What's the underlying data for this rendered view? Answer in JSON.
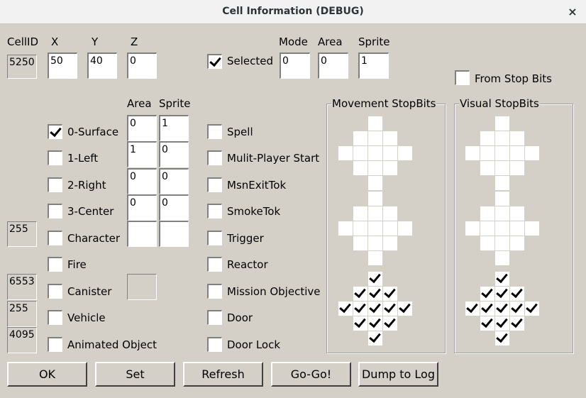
{
  "window": {
    "title": "Cell Information (DEBUG)",
    "close_glyph": "×"
  },
  "header": {
    "cellid_label": "CellID",
    "cellid_value": "5250",
    "x_label": "X",
    "x_value": "50",
    "y_label": "Y",
    "y_value": "40",
    "z_label": "Z",
    "z_value": "0",
    "selected_label": "Selected",
    "selected_checked": true,
    "mode_label": "Mode",
    "mode_value": "0",
    "area_label": "Area",
    "area_value": "0",
    "sprite_label": "Sprite",
    "sprite_value": "1",
    "from_stop_bits_label": "From Stop Bits"
  },
  "layers": {
    "area_header": "Area",
    "sprite_header": "Sprite",
    "items": [
      {
        "label": "0-Surface",
        "checked": true,
        "area": "0",
        "sprite": "1"
      },
      {
        "label": "1-Left",
        "checked": false,
        "area": "1",
        "sprite": "0"
      },
      {
        "label": "2-Right",
        "checked": false,
        "area": "0",
        "sprite": "0"
      },
      {
        "label": "3-Center",
        "checked": false,
        "area": "0",
        "sprite": "0"
      },
      {
        "label": "Character",
        "checked": false,
        "area": "",
        "sprite": ""
      },
      {
        "label": "Fire",
        "checked": false
      },
      {
        "label": "Canister",
        "checked": false
      },
      {
        "label": "Vehicle",
        "checked": false
      },
      {
        "label": "Animated Object",
        "checked": false
      }
    ]
  },
  "side_values": {
    "character": "255",
    "canister": "6553",
    "vehicle": "255",
    "animated": "4095"
  },
  "flags": {
    "items": [
      {
        "label": "Spell",
        "checked": false
      },
      {
        "label": "Mulit-Player Start",
        "checked": false
      },
      {
        "label": "MsnExitTok",
        "checked": false
      },
      {
        "label": "SmokeTok",
        "checked": false
      },
      {
        "label": "Trigger",
        "checked": false
      },
      {
        "label": "Reactor",
        "checked": false
      },
      {
        "label": "Mission Objective",
        "checked": false
      },
      {
        "label": "Door",
        "checked": false
      },
      {
        "label": "Door Lock",
        "checked": false
      }
    ]
  },
  "stopbits": {
    "movement_title": "Movement StopBits",
    "visual_title": "Visual StopBits",
    "movement_rows": [
      [],
      [],
      [
        0,
        1,
        2,
        3,
        4,
        5,
        6,
        7,
        8,
        9,
        10,
        11,
        12
      ]
    ],
    "visual_rows": [
      [],
      [],
      [
        0,
        1,
        2,
        3,
        4,
        5,
        6,
        7,
        8,
        9,
        10,
        11,
        12
      ]
    ]
  },
  "buttons": {
    "ok": "OK",
    "set": "Set",
    "refresh": "Refresh",
    "gogo": "Go-Go!",
    "dump": "Dump to Log"
  }
}
